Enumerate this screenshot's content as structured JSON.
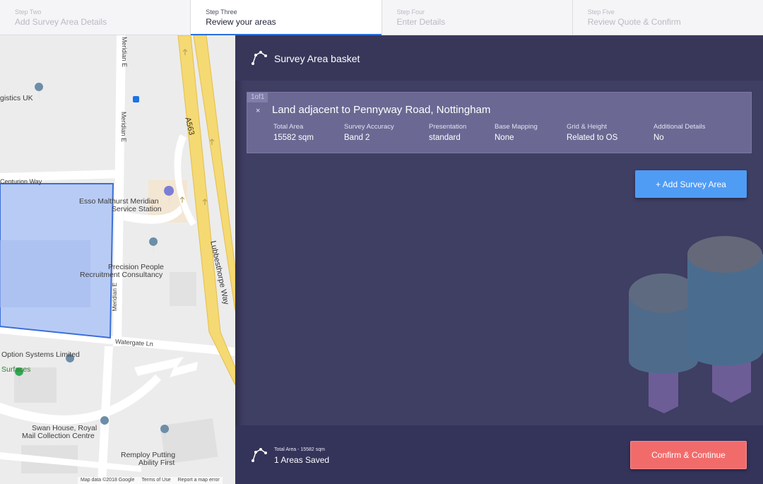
{
  "stepper": {
    "steps": [
      {
        "num": "Step Two",
        "title": "Add Survey Area Details"
      },
      {
        "num": "Step Three",
        "title": "Review your areas"
      },
      {
        "num": "Step Four",
        "title": "Enter Details"
      },
      {
        "num": "Step Five",
        "title": "Review Quote & Confirm"
      }
    ],
    "active_index": 1
  },
  "map": {
    "labels": {
      "logistics": "gistics UK",
      "meridian_e_1": "Meridian E",
      "meridian_e_2": "Meridian E",
      "meridian_e_3": "Meridian E",
      "centurion": "Centurion Way",
      "esso": "Esso Malthurst Meridian",
      "esso2": "Service Station",
      "precision": "Precision People",
      "precision2": "Recruitment Consultancy",
      "a563": "A563",
      "lubbesthorpe": "Lubbesthorpe Way",
      "watergate": "Watergate Ln",
      "option": "Option Systems Limited",
      "surfaces": "Surfaces",
      "swan": "Swan House, Royal",
      "swan2": "Mail Collection Centre",
      "remploy": "Remploy Putting",
      "remploy2": "Ability First"
    },
    "footer": {
      "data": "Map data ©2018 Google",
      "terms": "Terms of Use",
      "report": "Report a map error"
    }
  },
  "panel": {
    "header_title": "Survey Area basket",
    "card": {
      "counter": "1of1",
      "close": "×",
      "name": "Land adjacent to Pennyway Road, Nottingham",
      "attributes": [
        {
          "label": "Total Area",
          "value": "15582 sqm"
        },
        {
          "label": "Survey Accuracy",
          "value": "Band 2"
        },
        {
          "label": "Presentation",
          "value": "standard"
        },
        {
          "label": "Base Mapping",
          "value": "None"
        },
        {
          "label": "Grid & Height",
          "value": "Related to OS"
        },
        {
          "label": "Additional Details",
          "value": "No"
        }
      ]
    },
    "add_button": "+ Add Survey Area",
    "footer": {
      "total": "Total Area - 15582 sqm",
      "saved": "1 Areas Saved",
      "confirm_button": "Confirm & Continue"
    }
  },
  "colors": {
    "accent_blue": "#4f9cf5",
    "confirm_red": "#f26b6b",
    "panel_bg": "#3f3e63",
    "area_fill": "#b3c8f5"
  }
}
